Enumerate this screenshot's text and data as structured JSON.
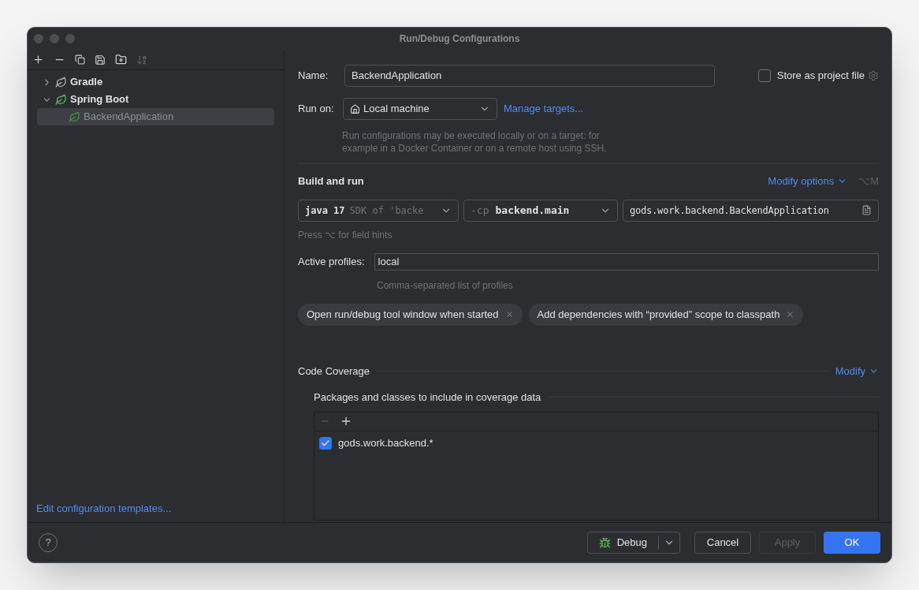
{
  "window": {
    "title": "Run/Debug Configurations"
  },
  "tree": [
    {
      "label": "Gradle",
      "kind": "gradle",
      "expanded": false,
      "selected": false
    },
    {
      "label": "Spring Boot",
      "kind": "spring",
      "expanded": true,
      "selected": false,
      "children": [
        {
          "label": "BackendApplication",
          "kind": "config",
          "selected": true
        }
      ]
    }
  ],
  "templates_link": "Edit configuration templates...",
  "name": {
    "label": "Name:",
    "value": "BackendApplication"
  },
  "store": {
    "label": "Store as project file",
    "checked": false
  },
  "run_on": {
    "label": "Run on:",
    "value": "Local machine",
    "link": "Manage targets...",
    "hint": "Run configurations may be executed locally or on a target: for example in a Docker Container or on a remote host using SSH."
  },
  "build": {
    "title": "Build and run",
    "modify": "Modify options",
    "shortcut": "⌥M",
    "jdk": {
      "main": "java 17",
      "sub": "SDK of 'backe"
    },
    "classpath": {
      "prefix": "-cp",
      "value": "backend.main"
    },
    "main_class": "gods.work.backend.BackendApplication",
    "hint": "Press ⌥ for field hints"
  },
  "profiles": {
    "label": "Active profiles:",
    "value": "local",
    "hint": "Comma-separated list of profiles"
  },
  "options": [
    {
      "label": "Open run/debug tool window when started"
    },
    {
      "label": "Add dependencies with “provided” scope to classpath"
    }
  ],
  "coverage": {
    "title": "Code Coverage",
    "modify": "Modify",
    "subtitle": "Packages and classes to include in coverage data",
    "items": [
      {
        "label": "gods.work.backend.*",
        "checked": true
      }
    ]
  },
  "buttons": {
    "help": "?",
    "debug": "Debug",
    "cancel": "Cancel",
    "apply": "Apply",
    "apply_disabled": true,
    "ok": "OK"
  }
}
